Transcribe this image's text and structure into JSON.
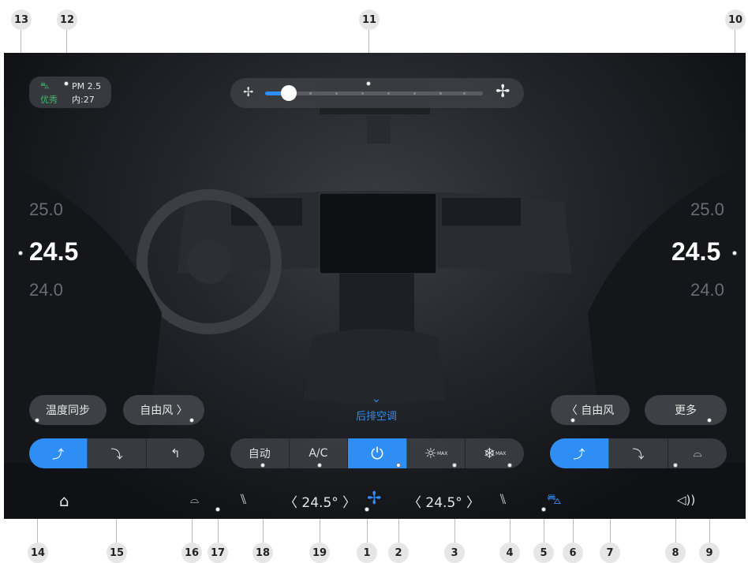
{
  "callouts": {
    "n1": "1",
    "n2": "2",
    "n3": "3",
    "n4": "4",
    "n5": "5",
    "n6": "6",
    "n7": "7",
    "n8": "8",
    "n9": "9",
    "n10": "10",
    "n11": "11",
    "n12": "12",
    "n13": "13",
    "n14": "14",
    "n15": "15",
    "n16": "16",
    "n17": "17",
    "n18": "18",
    "n19": "19"
  },
  "air_quality": {
    "pm_label": "PM 2.5",
    "rating": "优秀",
    "inner": "内:27",
    "color": "#3dbb6a"
  },
  "fan_slider": {
    "level": 0.1,
    "steps": 9
  },
  "left_temp": {
    "upper": "25.0",
    "current": "24.5",
    "lower": "24.0"
  },
  "right_temp": {
    "upper": "25.0",
    "current": "24.5",
    "lower": "24.0"
  },
  "buttons": {
    "temp_sync": "温度同步",
    "free_air_left": "自由风 〉",
    "rear_ac": "后排空调",
    "rear_chevron": "⌄",
    "free_air_right": "〈 自由风",
    "more": "更多"
  },
  "center_controls": {
    "auto": "自动",
    "ac": "A/C",
    "power": "⏻",
    "max_heat": "☼",
    "max_cool": "❄"
  },
  "bottom_bar": {
    "left_temp_display": "〈 24.5° 〉",
    "right_temp_display": "〈 24.5° 〉"
  },
  "colors": {
    "accent": "#2f8df6",
    "background": "#18191c"
  },
  "icons": [
    "home-icon",
    "rear-defrost-icon",
    "seat-left-icon",
    "fan-icon",
    "seat-right-icon",
    "car-icon",
    "volume-icon",
    "front-defrost-icon"
  ]
}
